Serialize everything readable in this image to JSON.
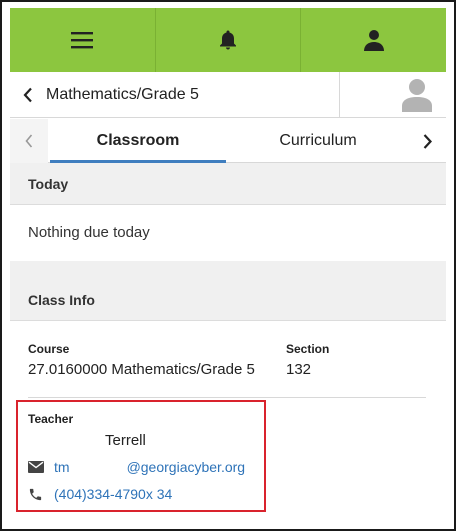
{
  "top_nav": {
    "menu_icon": "hamburger-menu-icon",
    "notification_icon": "bell-icon",
    "user_icon": "person-icon"
  },
  "course_header": {
    "title": "Mathematics/Grade 5",
    "back_icon": "chevron-left-icon",
    "avatar_icon": "person-silhouette-icon"
  },
  "tabs": {
    "items": [
      "Classroom",
      "Curriculum"
    ],
    "active": "Classroom"
  },
  "today": {
    "heading": "Today",
    "message": "Nothing due today"
  },
  "class_info": {
    "heading": "Class Info",
    "course_label": "Course",
    "course_value": "27.0160000 Mathematics/Grade 5",
    "section_label": "Section",
    "section_value": "132",
    "teacher_label": "Teacher",
    "teacher_name": "Terrell",
    "email_user": "tm",
    "email_domain": "@georgiacyber.org",
    "phone": "(404)334-4790x 34"
  },
  "colors": {
    "top_bar": "#8cc63f",
    "link": "#2e73b8",
    "highlight_box": "#d9232d",
    "tab_indicator": "#3f7ebf"
  }
}
